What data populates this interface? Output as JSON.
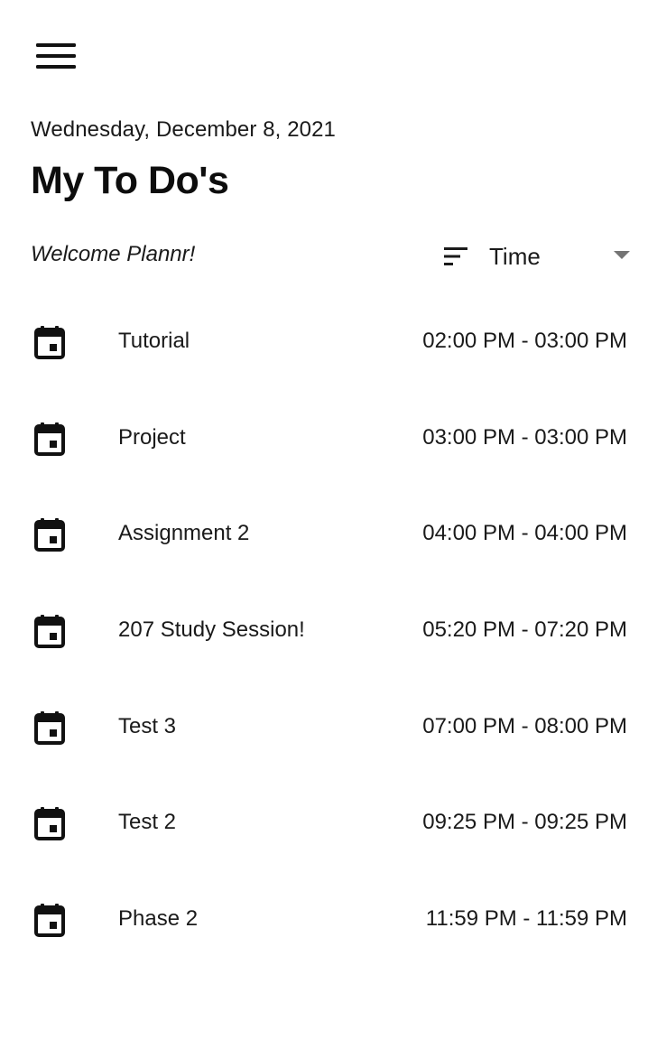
{
  "header": {
    "menu_icon": "hamburger-menu-icon",
    "date": "Wednesday, December 8, 2021",
    "title": "My To Do's",
    "welcome": "Welcome Plannr!"
  },
  "sort": {
    "icon": "sort-icon",
    "selected": "Time",
    "arrow_icon": "dropdown-arrow-icon"
  },
  "todos": [
    {
      "icon": "calendar-event-icon",
      "name": "Tutorial",
      "time": "02:00 PM - 03:00 PM"
    },
    {
      "icon": "calendar-event-icon",
      "name": "Project",
      "time": "03:00 PM - 03:00 PM"
    },
    {
      "icon": "calendar-event-icon",
      "name": "Assignment 2",
      "time": "04:00 PM - 04:00 PM"
    },
    {
      "icon": "calendar-event-icon",
      "name": "207 Study Session!",
      "time": "05:20 PM - 07:20 PM"
    },
    {
      "icon": "calendar-event-icon",
      "name": "Test 3",
      "time": "07:00 PM - 08:00 PM"
    },
    {
      "icon": "calendar-event-icon",
      "name": "Test 2",
      "time": "09:25 PM - 09:25 PM"
    },
    {
      "icon": "calendar-event-icon",
      "name": "Phase 2",
      "time": "11:59 PM - 11:59 PM"
    }
  ],
  "colors": {
    "background": "#ffffff",
    "text": "#1a1a1a",
    "icon": "#111111",
    "dropdown_arrow": "#757575"
  }
}
